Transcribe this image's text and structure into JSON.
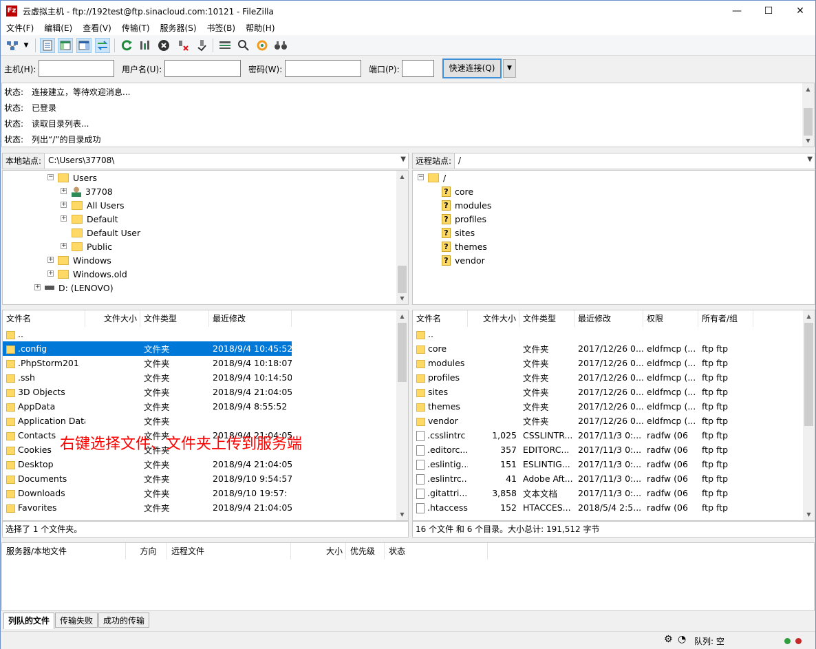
{
  "window": {
    "title": "云虚拟主机 - ftp://192test@ftp.sinacloud.com:10121 - FileZilla",
    "minimize": "—",
    "maximize": "☐",
    "close": "✕"
  },
  "menu": [
    "文件(F)",
    "编辑(E)",
    "查看(V)",
    "传输(T)",
    "服务器(S)",
    "书签(B)",
    "帮助(H)"
  ],
  "toolbar": {
    "icons": [
      "site-manager-icon",
      "dropdown-arrow-icon",
      "toggle-log-icon",
      "toggle-local-tree-icon",
      "toggle-remote-tree-icon",
      "toggle-queue-icon",
      "refresh-icon",
      "process-queue-icon",
      "cancel-icon",
      "disconnect-icon",
      "reconnect-icon",
      "directory-listing-filters-icon",
      "toggle-comparison-icon",
      "sync-browsing-icon",
      "search-icon"
    ]
  },
  "quickconnect": {
    "host_label": "主机(H):",
    "user_label": "用户名(U):",
    "pass_label": "密码(W):",
    "port_label": "端口(P):",
    "host_value": "",
    "user_value": "",
    "pass_value": "",
    "port_value": "",
    "connect_label": "快速连接(Q)",
    "dropdown": "▼"
  },
  "log": [
    {
      "key": "状态:",
      "msg": "连接建立，等待欢迎消息..."
    },
    {
      "key": "状态:",
      "msg": "已登录"
    },
    {
      "key": "状态:",
      "msg": "读取目录列表..."
    },
    {
      "key": "状态:",
      "msg": "列出“/”的目录成功"
    }
  ],
  "local": {
    "site_label": "本地站点:",
    "path": "C:\\Users\\37708\\",
    "tree": [
      {
        "label": "Users",
        "type": "folder"
      },
      {
        "label": "37708",
        "type": "user"
      },
      {
        "label": "All Users",
        "type": "folder"
      },
      {
        "label": "Default",
        "type": "folder"
      },
      {
        "label": "Default User",
        "type": "folder"
      },
      {
        "label": "Public",
        "type": "folder"
      },
      {
        "label": "Windows",
        "type": "folder"
      },
      {
        "label": "Windows.old",
        "type": "folder"
      },
      {
        "label": "D: (LENOVO)",
        "type": "drive"
      }
    ],
    "columns": [
      "文件名",
      "文件大小",
      "文件类型",
      "最近修改"
    ],
    "files": [
      {
        "name": "..",
        "size": "",
        "type": "",
        "modified": ""
      },
      {
        "name": ".config",
        "size": "",
        "type": "文件夹",
        "modified": "2018/9/4 10:45:52"
      },
      {
        "name": ".PhpStorm201",
        "size": "",
        "type": "文件夹",
        "modified": "2018/9/4 10:18:07"
      },
      {
        "name": ".ssh",
        "size": "",
        "type": "文件夹",
        "modified": "2018/9/4 10:14:50"
      },
      {
        "name": "3D Objects",
        "size": "",
        "type": "文件夹",
        "modified": "2018/9/4 21:04:05"
      },
      {
        "name": "AppData",
        "size": "",
        "type": "文件夹",
        "modified": "2018/9/4 8:55:52"
      },
      {
        "name": "Application Data",
        "size": "",
        "type": "文件夹",
        "modified": ""
      },
      {
        "name": "Contacts",
        "size": "",
        "type": "文件夹",
        "modified": "2018/9/4 21:04:05"
      },
      {
        "name": "Cookies",
        "size": "",
        "type": "文件夹",
        "modified": ""
      },
      {
        "name": "Desktop",
        "size": "",
        "type": "文件夹",
        "modified": "2018/9/4 21:04:05"
      },
      {
        "name": "Documents",
        "size": "",
        "type": "文件夹",
        "modified": "2018/9/10 9:54:57"
      },
      {
        "name": "Downloads",
        "size": "",
        "type": "文件夹",
        "modified": "2018/9/10 19:57:"
      },
      {
        "name": "Favorites",
        "size": "",
        "type": "文件夹",
        "modified": "2018/9/4 21:04:05"
      }
    ],
    "status": "选择了 1 个文件夹。"
  },
  "annotation": "右键选择文件、文件夹上传到服务端",
  "remote": {
    "site_label": "远程站点:",
    "path": "/",
    "tree": [
      {
        "label": "/",
        "type": "folder"
      },
      {
        "label": "core",
        "type": "unknown"
      },
      {
        "label": "modules",
        "type": "unknown"
      },
      {
        "label": "profiles",
        "type": "unknown"
      },
      {
        "label": "sites",
        "type": "unknown"
      },
      {
        "label": "themes",
        "type": "unknown"
      },
      {
        "label": "vendor",
        "type": "unknown"
      }
    ],
    "columns": [
      "文件名",
      "文件大小",
      "文件类型",
      "最近修改",
      "权限",
      "所有者/组"
    ],
    "files": [
      {
        "name": "..",
        "size": "",
        "type": "",
        "modified": "",
        "perm": "",
        "owner": "",
        "icon": "folder"
      },
      {
        "name": "core",
        "size": "",
        "type": "文件夹",
        "modified": "2017/12/26 0...",
        "perm": "eldfmcp (...",
        "owner": "ftp ftp",
        "icon": "folder"
      },
      {
        "name": "modules",
        "size": "",
        "type": "文件夹",
        "modified": "2017/12/26 0...",
        "perm": "eldfmcp (...",
        "owner": "ftp ftp",
        "icon": "folder"
      },
      {
        "name": "profiles",
        "size": "",
        "type": "文件夹",
        "modified": "2017/12/26 0...",
        "perm": "eldfmcp (...",
        "owner": "ftp ftp",
        "icon": "folder"
      },
      {
        "name": "sites",
        "size": "",
        "type": "文件夹",
        "modified": "2017/12/26 0...",
        "perm": "eldfmcp (...",
        "owner": "ftp ftp",
        "icon": "folder"
      },
      {
        "name": "themes",
        "size": "",
        "type": "文件夹",
        "modified": "2017/12/26 0...",
        "perm": "eldfmcp (...",
        "owner": "ftp ftp",
        "icon": "folder"
      },
      {
        "name": "vendor",
        "size": "",
        "type": "文件夹",
        "modified": "2017/12/26 0...",
        "perm": "eldfmcp (...",
        "owner": "ftp ftp",
        "icon": "folder"
      },
      {
        "name": ".csslintrc",
        "size": "1,025",
        "type": "CSSLINTR...",
        "modified": "2017/11/3 0:...",
        "perm": "radfw (06",
        "owner": "ftp ftp",
        "icon": "doc"
      },
      {
        "name": ".editorc...",
        "size": "357",
        "type": "EDITORC...",
        "modified": "2017/11/3 0:...",
        "perm": "radfw (06",
        "owner": "ftp ftp",
        "icon": "doc"
      },
      {
        "name": ".eslintig...",
        "size": "151",
        "type": "ESLINTIG...",
        "modified": "2017/11/3 0:...",
        "perm": "radfw (06",
        "owner": "ftp ftp",
        "icon": "doc"
      },
      {
        "name": ".eslintrc....",
        "size": "41",
        "type": "Adobe Aft...",
        "modified": "2017/11/3 0:...",
        "perm": "radfw (06",
        "owner": "ftp ftp",
        "icon": "doc"
      },
      {
        "name": ".gitattri...",
        "size": "3,858",
        "type": "文本文档",
        "modified": "2017/11/3 0:...",
        "perm": "radfw (06",
        "owner": "ftp ftp",
        "icon": "doc"
      },
      {
        "name": ".htaccess",
        "size": "152",
        "type": "HTACCES...",
        "modified": "2018/5/4 2:5...",
        "perm": "radfw (06",
        "owner": "ftp ftp",
        "icon": "doc"
      }
    ],
    "status": "16 个文件 和 6 个目录。大小总计: 191,512 字节"
  },
  "queue": {
    "columns": [
      "服务器/本地文件",
      "方向",
      "远程文件",
      "大小",
      "优先级",
      "状态"
    ],
    "tabs": [
      "列队的文件",
      "传输失败",
      "成功的传输"
    ]
  },
  "statusbar": {
    "queue_label": "队列: 空"
  },
  "colors": {
    "selection": "#0078d7",
    "annotation": "#ff0000",
    "accent": "#3c8fd8"
  }
}
